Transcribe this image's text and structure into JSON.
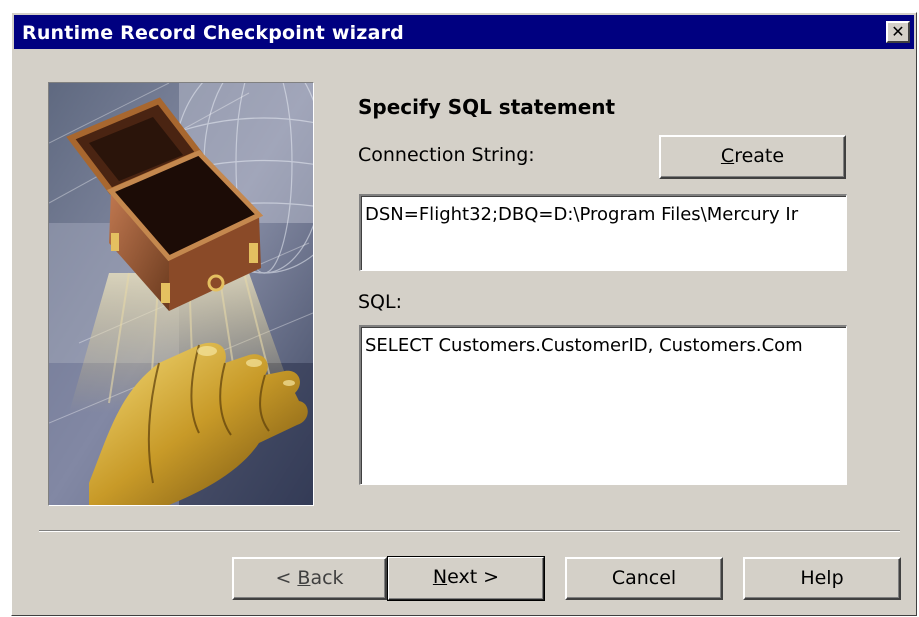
{
  "window": {
    "title": "Runtime Record Checkpoint wizard",
    "close_symbol": "✕"
  },
  "illustration": {
    "icon": "treasure-box-and-golden-hand-illustration"
  },
  "main": {
    "heading": "Specify SQL statement",
    "connection_label": "Connection String:",
    "create_button": {
      "accel": "C",
      "rest": "reate"
    },
    "connection_value": "DSN=Flight32;DBQ=D:\\Program Files\\Mercury Ir",
    "sql_label": "SQL:",
    "sql_value": "SELECT Customers.CustomerID, Customers.Com"
  },
  "footer": {
    "back_button": {
      "prefix": "< ",
      "accel": "B",
      "rest": "ack"
    },
    "next_button": {
      "accel": "N",
      "rest": "ext >"
    },
    "cancel_label": "Cancel",
    "help_label": "Help"
  },
  "colors": {
    "titlebar": "#000080",
    "dialog": "#d4d0c8"
  }
}
